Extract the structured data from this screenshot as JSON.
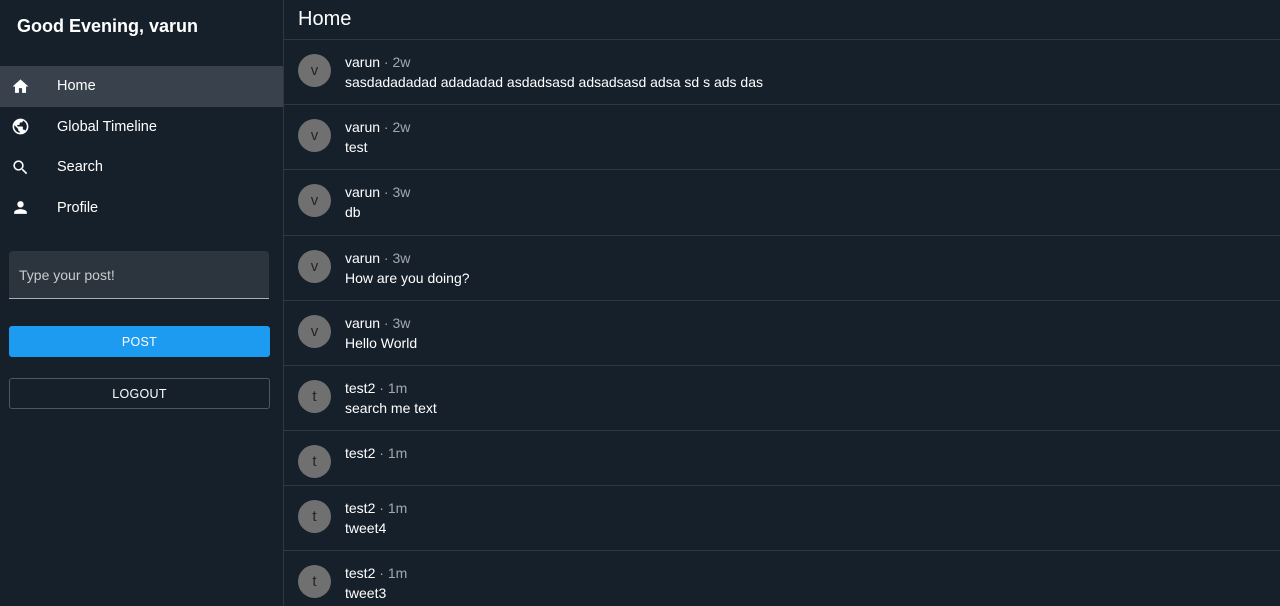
{
  "sidebar": {
    "greeting": "Good Evening, varun",
    "items": [
      {
        "label": "Home",
        "icon": "home-icon",
        "active": true
      },
      {
        "label": "Global Timeline",
        "icon": "globe-icon",
        "active": false
      },
      {
        "label": "Search",
        "icon": "search-icon",
        "active": false
      },
      {
        "label": "Profile",
        "icon": "person-icon",
        "active": false
      }
    ],
    "composer": {
      "placeholder": "Type your post!",
      "value": ""
    },
    "post_label": "POST",
    "logout_label": "LOGOUT"
  },
  "main": {
    "title": "Home",
    "posts": [
      {
        "avatar": "v",
        "author": "varun",
        "sep": "·",
        "time": "2w",
        "text": "sasdadadadad adadadad asdadsasd adsadsasd adsa sd s ads das"
      },
      {
        "avatar": "v",
        "author": "varun",
        "sep": "·",
        "time": "2w",
        "text": "test"
      },
      {
        "avatar": "v",
        "author": "varun",
        "sep": "·",
        "time": "3w",
        "text": "db"
      },
      {
        "avatar": "v",
        "author": "varun",
        "sep": "·",
        "time": "3w",
        "text": "How are you doing?"
      },
      {
        "avatar": "v",
        "author": "varun",
        "sep": "·",
        "time": "3w",
        "text": "Hello World"
      },
      {
        "avatar": "t",
        "author": "test2",
        "sep": "·",
        "time": "1m",
        "text": "search me text"
      },
      {
        "avatar": "t",
        "author": "test2",
        "sep": "·",
        "time": "1m",
        "text": ""
      },
      {
        "avatar": "t",
        "author": "test2",
        "sep": "·",
        "time": "1m",
        "text": "tweet4"
      },
      {
        "avatar": "t",
        "author": "test2",
        "sep": "·",
        "time": "1m",
        "text": "tweet3"
      }
    ]
  },
  "colors": {
    "background": "#16202b",
    "active_nav": "#38414c",
    "accent": "#1d9bf0",
    "avatar": "#707070",
    "border": "#2e3842"
  }
}
